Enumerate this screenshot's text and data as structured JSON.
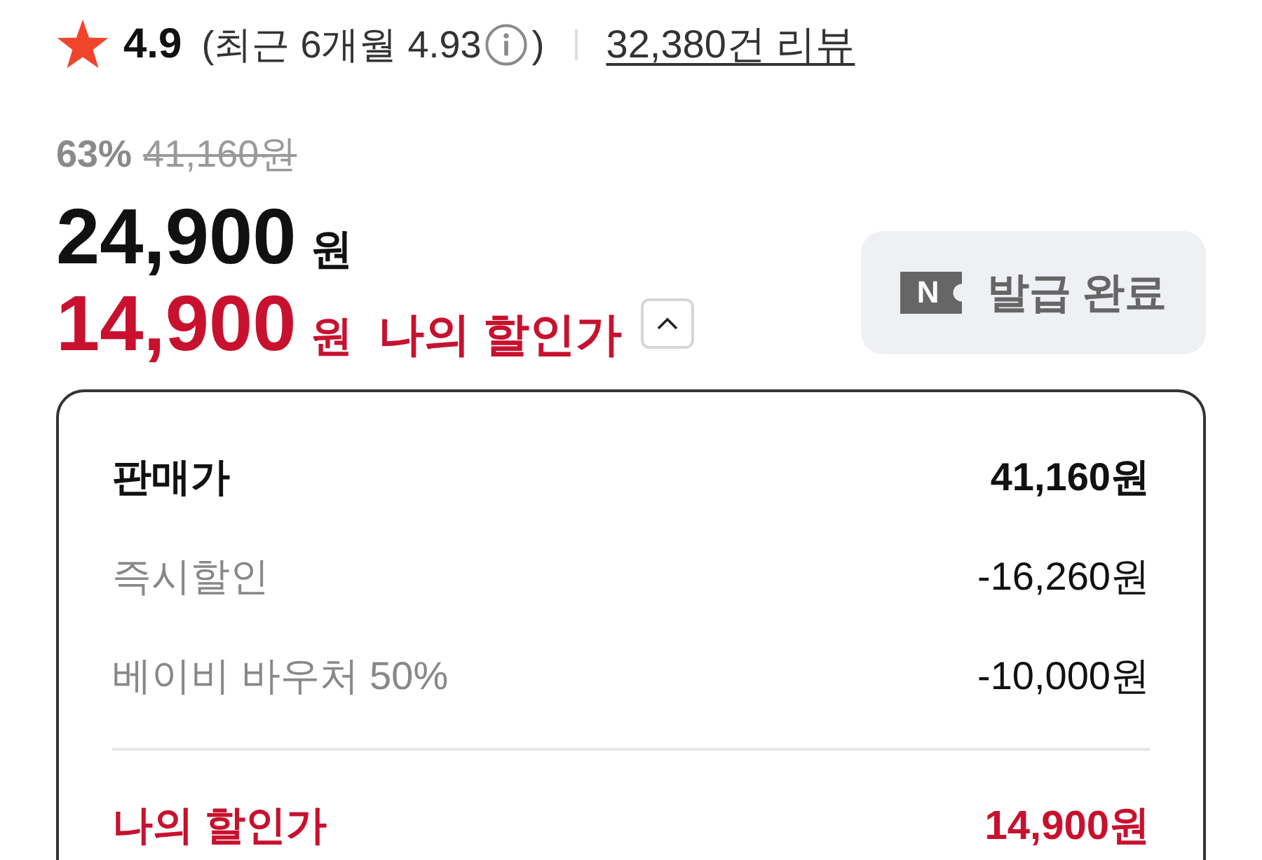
{
  "rating": {
    "score": "4.9",
    "recent": "(최근 6개월 4.93",
    "recent_close": ")",
    "reviews_link": "32,380건 리뷰"
  },
  "price": {
    "discount_rate": "63%",
    "original_price": "41,160원",
    "sale_amount": "24,900",
    "sale_unit": "원"
  },
  "my_price": {
    "amount": "14,900",
    "unit": "원",
    "label": "나의 할인가",
    "expanded": true
  },
  "coupon_button": {
    "badge": "N",
    "label": "발급 완료"
  },
  "breakdown": [
    {
      "kind": "base",
      "label": "판매가",
      "value": "41,160원"
    },
    {
      "kind": "discount",
      "label": "즉시할인",
      "value": "-16,260원"
    },
    {
      "kind": "discount",
      "label": "베이비 바우처 50%",
      "value": "-10,000원"
    },
    {
      "kind": "total",
      "label": "나의 할인가",
      "value": "14,900원"
    }
  ]
}
